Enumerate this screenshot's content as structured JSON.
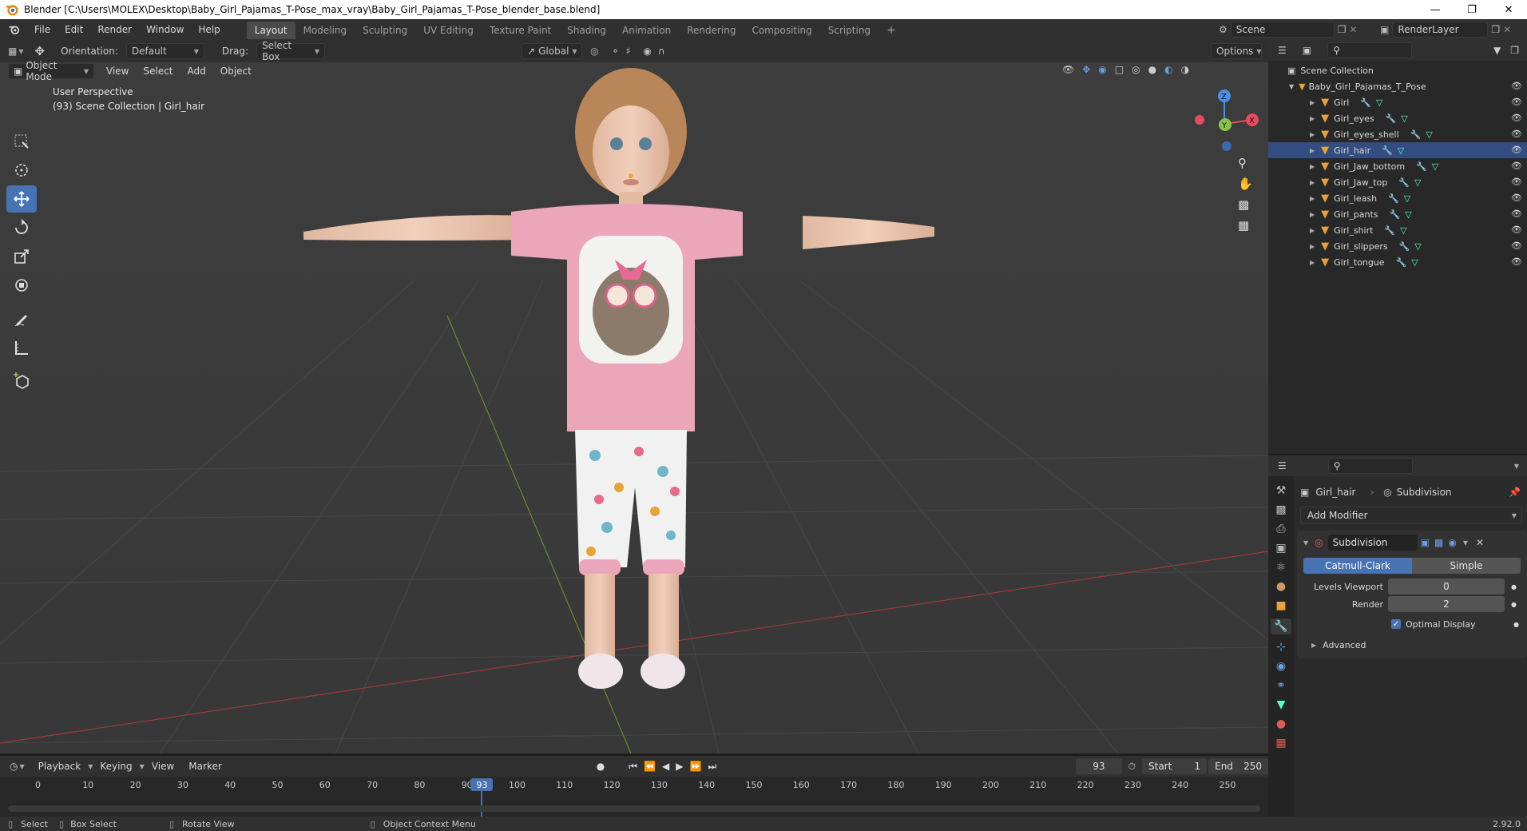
{
  "window": {
    "title": "Blender [C:\\Users\\MOLEX\\Desktop\\Baby_Girl_Pajamas_T-Pose_max_vray\\Baby_Girl_Pajamas_T-Pose_blender_base.blend]"
  },
  "menu": {
    "items": [
      "File",
      "Edit",
      "Render",
      "Window",
      "Help"
    ]
  },
  "workspaces": [
    "Layout",
    "Modeling",
    "Sculpting",
    "UV Editing",
    "Texture Paint",
    "Shading",
    "Animation",
    "Rendering",
    "Compositing",
    "Scripting"
  ],
  "active_workspace": "Layout",
  "scene": {
    "name": "Scene",
    "render_layer": "RenderLayer"
  },
  "tool_header": {
    "orientation_label": "Orientation:",
    "orientation_value": "Default",
    "drag_label": "Drag:",
    "drag_value": "Select Box",
    "transform_orientation": "Global",
    "options": "Options"
  },
  "viewport_header": {
    "mode": "Object Mode",
    "menus": [
      "View",
      "Select",
      "Add",
      "Object"
    ]
  },
  "viewport": {
    "perspective": "User Perspective",
    "collection_info": "(93) Scene Collection | Girl_hair"
  },
  "gizmo": {
    "z": "Z",
    "y": "Y",
    "x": "X"
  },
  "outliner": {
    "root": "Scene Collection",
    "collection": "Baby_Girl_Pajamas_T_Pose",
    "objects": [
      "Girl",
      "Girl_eyes",
      "Girl_eyes_shell",
      "Girl_hair",
      "Girl_Jaw_bottom",
      "Girl_Jaw_top",
      "Girl_leash",
      "Girl_pants",
      "Girl_shirt",
      "Girl_slippers",
      "Girl_tongue"
    ],
    "selected": "Girl_hair"
  },
  "properties": {
    "object_name": "Girl_hair",
    "modifier_context": "Subdivision",
    "add_modifier": "Add Modifier",
    "modifier_name": "Subdivision",
    "algorithm_options": [
      "Catmull-Clark",
      "Simple"
    ],
    "algorithm_selected": "Catmull-Clark",
    "levels_viewport_label": "Levels Viewport",
    "levels_viewport_value": "0",
    "render_label": "Render",
    "render_value": "2",
    "optimal_display_label": "Optimal Display",
    "optimal_display_checked": true,
    "advanced_label": "Advanced"
  },
  "timeline": {
    "menus": [
      "Playback",
      "Keying",
      "View",
      "Marker"
    ],
    "current_frame": "93",
    "start_label": "Start",
    "start_value": "1",
    "end_label": "End",
    "end_value": "250",
    "ruler": [
      "0",
      "10",
      "20",
      "30",
      "40",
      "50",
      "60",
      "70",
      "80",
      "90",
      "100",
      "110",
      "120",
      "130",
      "140",
      "150",
      "160",
      "170",
      "180",
      "190",
      "200",
      "210",
      "220",
      "230",
      "240",
      "250"
    ],
    "playhead_label": "93"
  },
  "statusbar": {
    "select": "Select",
    "box_select": "Box Select",
    "rotate_view": "Rotate View",
    "context_menu": "Object Context Menu",
    "version": "2.92.0"
  },
  "colors": {
    "accent": "#4772b3",
    "selected_row": "#334d80",
    "x_axis": "#e84a5f",
    "y_axis": "#8bc34a",
    "z_axis": "#4a90e2",
    "mesh_icon": "#e8a33a"
  }
}
